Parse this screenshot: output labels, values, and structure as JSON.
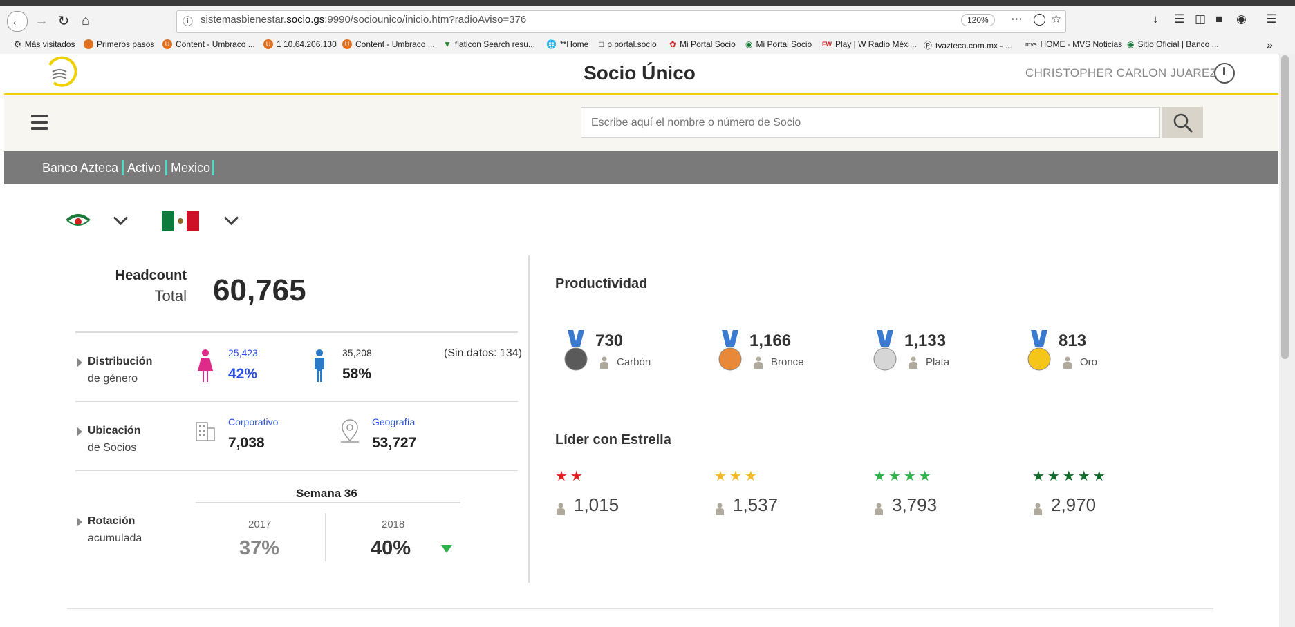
{
  "browser": {
    "url_prefix": "sistemasbienestar.",
    "url_domain": "socio.gs",
    "url_suffix": ":9990/sociounico/inicio.htm?radioAviso=376",
    "zoom": "120%",
    "bookmarks": [
      "Más visitados",
      "Primeros pasos",
      "Content - Umbraco ...",
      "1 10.64.206.130",
      "Content - Umbraco ...",
      "flaticon Search resu...",
      "**Home",
      "p portal.socio",
      "Mi Portal Socio",
      "Mi Portal Socio",
      "Play | W Radio Méxi...",
      "tvazteca.com.mx - ...",
      "HOME - MVS Noticias",
      "Sitio Oficial | Banco ..."
    ]
  },
  "header": {
    "title": "Socio Único",
    "user": "CHRISTOPHER CARLON JUAREZ"
  },
  "search": {
    "placeholder": "Escribe aquí el nombre o número de Socio"
  },
  "breadcrumb": [
    "Banco Azteca",
    "Activo",
    "Mexico"
  ],
  "headcount": {
    "label": "Headcount",
    "sublabel": "Total",
    "value": "60,765"
  },
  "gender": {
    "title": "Distribución",
    "subtitle": "de género",
    "female_count": "25,423",
    "female_pct": "42%",
    "male_count": "35,208",
    "male_pct": "58%",
    "no_data": "(Sin datos: 134)"
  },
  "location": {
    "title": "Ubicación",
    "subtitle": "de Socios",
    "corp_label": "Corporativo",
    "corp_value": "7,038",
    "geo_label": "Geografía",
    "geo_value": "53,727"
  },
  "rotation": {
    "title": "Rotación",
    "subtitle": "acumulada",
    "week": "Semana 36",
    "year1": "2017",
    "year1_value": "37%",
    "year2": "2018",
    "year2_value": "40%"
  },
  "productivity": {
    "title": "Productividad",
    "medals": [
      {
        "value": "730",
        "label": "Carbón",
        "color": "#5a5a5a"
      },
      {
        "value": "1,166",
        "label": "Bronce",
        "color": "#e8893a"
      },
      {
        "value": "1,133",
        "label": "Plata",
        "color": "#d6d6d6"
      },
      {
        "value": "813",
        "label": "Oro",
        "color": "#f5c518"
      }
    ]
  },
  "leaders": {
    "title": "Líder con Estrella",
    "groups": [
      {
        "stars": "★★",
        "value": "1,015",
        "color": "#e02020"
      },
      {
        "stars": "★★★",
        "value": "1,537",
        "color": "#f5b829"
      },
      {
        "stars": "★★★★",
        "value": "3,793",
        "color": "#2fb34a"
      },
      {
        "stars": "★★★★★",
        "value": "2,970",
        "color": "#0f6b2a"
      }
    ]
  }
}
